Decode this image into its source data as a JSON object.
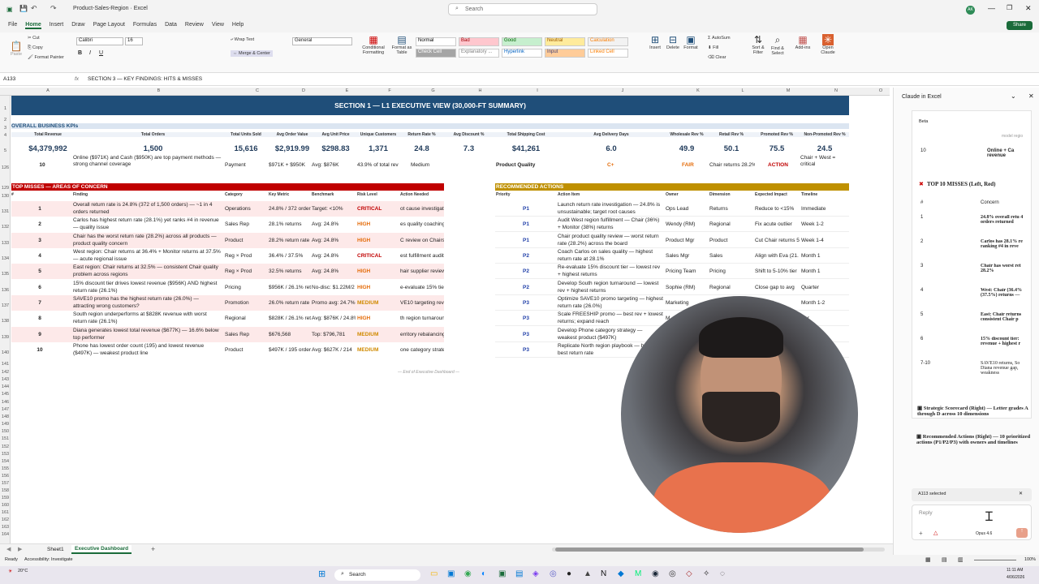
{
  "title": {
    "doc": "Product-Sales-Region · Excel",
    "search": "Search",
    "avatar": "AK"
  },
  "tabs": [
    "File",
    "Home",
    "Insert",
    "Draw",
    "Page Layout",
    "Formulas",
    "Data",
    "Review",
    "View",
    "Help"
  ],
  "share": "Share",
  "ribbon": {
    "font": "Calibri",
    "size": "16",
    "wrap": "Wrap Text",
    "merge": "Merge & Center",
    "numfmt": "General",
    "styles": [
      "Normal",
      "Bad",
      "Good",
      "Neutral",
      "Calculation",
      "Check Cell",
      "Explanatory ...",
      "Hyperlink",
      "Input",
      "Linked Cell"
    ],
    "cond": "Conditional Formatting",
    "fmttable": "Format as Table",
    "insert": "Insert",
    "delete": "Delete",
    "format": "Format",
    "autosum": "AutoSum",
    "fill": "Fill",
    "clear": "Clear",
    "sort": "Sort & Filter",
    "find": "Find & Select",
    "addins": "Add-ins",
    "openclaude": "Open Claude",
    "cut": "Cut",
    "copy": "Copy",
    "painter": "Format Painter",
    "paste": "Paste",
    "groups": [
      "Clipboard",
      "Font",
      "Alignment",
      "Number",
      "Styles",
      "Cells",
      "Editing",
      "Add-ins",
      "Claude"
    ]
  },
  "formula": {
    "ref": "A133",
    "fx": "fx",
    "value": "SECTION 3 — KEY FINDINGS: HITS & MISSES"
  },
  "cols": [
    "A",
    "B",
    "C",
    "D",
    "E",
    "F",
    "G",
    "H",
    "I",
    "J",
    "K",
    "L",
    "M",
    "N",
    "O"
  ],
  "section": "SECTION 1 — L1 EXECUTIVE VIEW (30,000-FT SUMMARY)",
  "kpi": {
    "title": "OVERALL BUSINESS KPIs",
    "labels": [
      "Total Revenue",
      "Total Orders",
      "Total Units Sold",
      "Avg Order Value",
      "Avg Unit Price",
      "Unique Customers",
      "Return Rate %",
      "Avg Discount %",
      "Total Shipping Cost",
      "Avg Delivery Days",
      "Wholesale Rev %",
      "Retail Rev %",
      "Promoted Rev %",
      "Non-Promoted Rev %"
    ],
    "values": [
      "$4,379,992",
      "1,500",
      "15,616",
      "$2,919.99",
      "$298.83",
      "1,371",
      "24.8",
      "7.3",
      "$41,261",
      "6.0",
      "49.9",
      "50.1",
      "75.5",
      "24.5"
    ]
  },
  "row126": {
    "n": "10",
    "finding": "Online ($971K) and Cash ($950K) are top payment methods — strong channel coverage",
    "cat": "Payment",
    "metric": "$971K + $950K",
    "bench": "Avg: $876K",
    "pct": "43.9% of total rev",
    "level": "Medium",
    "pq": "Product Quality",
    "grade": "C+",
    "fair": "FAIR",
    "note": "Chair returns 28.2%",
    "action": "ACTION",
    "last": "Chair + West = critical"
  },
  "misses": {
    "title": "TOP MISSES — AREAS OF CONCERN",
    "headers": [
      "#",
      "Finding",
      "Category",
      "Key Metric",
      "Benchmark",
      "Risk Level",
      "Action Needed"
    ],
    "rows": [
      [
        "1",
        "Overall return rate is 24.8% (372 of 1,500 orders) — ~1 in 4 orders returned",
        "Operations",
        "24.8% / 372 orders",
        "Target: <10%",
        "CRITICAL",
        "ot cause investigation"
      ],
      [
        "2",
        "Carlos has highest return rate (28.1%) yet ranks #4 in revenue — quality issue",
        "Sales Rep",
        "28.1% returns",
        "Avg: 24.8%",
        "HIGH",
        "es quality coaching"
      ],
      [
        "3",
        "Chair has the worst return rate (28.2%) across all products — product quality concern",
        "Product",
        "28.2% return rate",
        "Avg: 24.8%",
        "HIGH",
        "C review on Chairs"
      ],
      [
        "4",
        "West region: Chair returns at 36.4% + Monitor returns at 37.5% — acute regional issue",
        "Reg × Prod",
        "36.4% / 37.5%",
        "Avg: 24.8%",
        "CRITICAL",
        "est fulfillment audit"
      ],
      [
        "5",
        "East region: Chair returns at 32.5% — consistent Chair quality problem across regions",
        "Reg × Prod",
        "32.5% returns",
        "Avg: 24.8%",
        "HIGH",
        "hair supplier review"
      ],
      [
        "6",
        "15% discount tier drives lowest revenue ($956K) AND highest return rate (26.1%)",
        "Pricing",
        "$956K / 26.1% ret",
        "No-disc: $1.22M/2",
        "HIGH",
        "e-evaluate 15% tier"
      ],
      [
        "7",
        "SAVE10 promo has the highest return rate (26.0%) — attracting wrong customers?",
        "Promotion",
        "26.0% return rate",
        "Promo avg: 24.7%",
        "MEDIUM",
        "VE10 targeting review"
      ],
      [
        "8",
        "South region underperforms at $828K revenue with worst return rate (26.1%)",
        "Regional",
        "$828K / 26.1% ret",
        "Avg: $876K / 24.8%",
        "HIGH",
        "th region turnaround"
      ],
      [
        "9",
        "Diana generates lowest total revenue ($677K) — 16.6% below top performer",
        "Sales Rep",
        "$676,568",
        "Top: $796,781",
        "MEDIUM",
        "erritory rebalancing"
      ],
      [
        "10",
        "Phone has lowest order count (195) and lowest revenue ($497K) — weakest product line",
        "Product",
        "$497K / 195 orders",
        "Avg: $627K / 214",
        "MEDIUM",
        "one category strategy"
      ]
    ]
  },
  "actions": {
    "title": "RECOMMENDED ACTIONS",
    "headers": [
      "Priority",
      "Action Item",
      "Owner",
      "Dimension",
      "Expected Impact",
      "Timeline"
    ],
    "rows": [
      [
        "P1",
        "Launch return rate investigation — 24.8% is unsustainable; target root causes",
        "Ops Lead",
        "Returns",
        "Reduce to <15%",
        "Immediate"
      ],
      [
        "P1",
        "Audit West region fulfillment — Chair (36%) + Monitor (38%) returns",
        "Wendy (RM)",
        "Regional",
        "Fix acute outlier",
        "Week 1-2"
      ],
      [
        "P1",
        "Chair product quality review — worst return rate (28.2%) across the board",
        "Product Mgr",
        "Product",
        "Cut Chair returns 5",
        "Week 1-4"
      ],
      [
        "P2",
        "Coach Carlos on sales quality — highest return rate at 28.1%",
        "Sales Mgr",
        "Sales",
        "Align with Eva (21.",
        "Month 1"
      ],
      [
        "P2",
        "Re-evaluate 15% discount tier — lowest rev + highest returns",
        "Pricing Team",
        "Pricing",
        "Shift to 5-10% tier",
        "Month 1"
      ],
      [
        "P2",
        "Develop South region turnaround — lowest rev + highest returns",
        "Sophie (RM)",
        "Regional",
        "Close gap to avg",
        "Quarter"
      ],
      [
        "P3",
        "Optimize SAVE10 promo targeting — highest return rate (26.0%)",
        "Marketing",
        "",
        "tomer fit",
        "Month 1-2"
      ],
      [
        "P3",
        "Scale FREESHIP promo — best rev + lowest returns; expand reach",
        "M",
        "",
        "",
        "rter"
      ],
      [
        "P3",
        "Develop Phone category strategy — weakest product ($497K)",
        "",
        "",
        "",
        ""
      ],
      [
        "P3",
        "Replicate North region playbook — best rev, best return rate",
        "",
        "",
        "",
        ""
      ]
    ]
  },
  "endnote": "— End of Executive Dashboard —",
  "rownums": [
    "1",
    "2",
    "3",
    "4",
    "5",
    "126",
    "129",
    "130",
    "131",
    "132",
    "133",
    "134",
    "135",
    "136",
    "137",
    "138",
    "139",
    "140",
    "141",
    "142",
    "143",
    "144",
    "145",
    "146",
    "147",
    "148",
    "149",
    "150",
    "151",
    "152",
    "153",
    "154",
    "155",
    "156",
    "157",
    "158",
    "159",
    "160",
    "161",
    "162",
    "163",
    "164"
  ],
  "sheets": [
    "Sheet1",
    "Executive Dashboard"
  ],
  "status": {
    "ready": "Ready",
    "access": "Accessibility: Investigate",
    "zoom": "100%"
  },
  "panel": {
    "title": "Claude in Excel",
    "beta": "Beta",
    "model": "model regio",
    "row10": "10",
    "row10text": "Online + Ca revenue",
    "missTitle": "TOP 10 MISSES (Left, Red)",
    "colN": "#",
    "colC": "Concern",
    "items": [
      [
        "1",
        "24.8% overall retu 4 orders returned"
      ],
      [
        "2",
        "Carlos has 28.1% re ranking #4 in reve"
      ],
      [
        "3",
        "Chair has worst ret 28.2%"
      ],
      [
        "4",
        "West: Chair (36.4% (37.5%) returns —"
      ],
      [
        "5",
        "East: Chair returns consistent Chair p"
      ],
      [
        "6",
        "15% discount tier: revenue + highest r"
      ],
      [
        "7-10",
        "SAVE10 returns, So Diana revenue gap, weakness"
      ]
    ],
    "b1": "Strategic Scorecard (Right) — Letter grades A through D across 10 dimensions",
    "b2": "Recommended Actions (Right) — 10 prioritized actions (P1/P2/P3) with owners and timelines",
    "selected": "A113 selected",
    "reply": "Reply",
    "modelname": "Opus 4.6"
  },
  "taskbar": {
    "search": "Search",
    "weather": "20°C",
    "time": "11:11 AM",
    "date": "4/06/2026"
  },
  "colors": {
    "banner": "#1f4e79",
    "red": "#c00000",
    "gold": "#bf9000",
    "green": "#1a6b3a"
  }
}
